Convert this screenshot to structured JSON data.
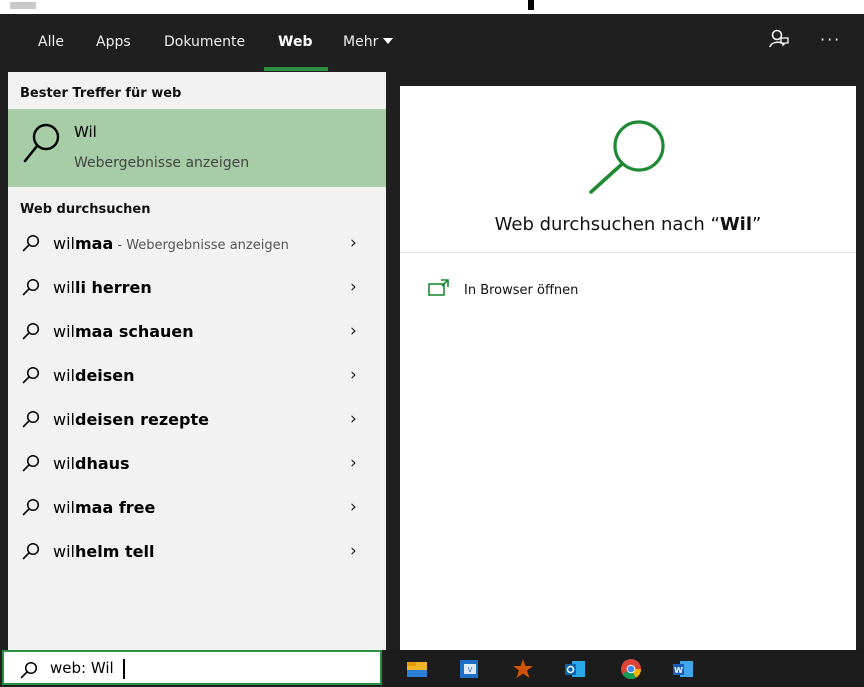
{
  "tabs": [
    {
      "label": "Alle",
      "active": false
    },
    {
      "label": "Apps",
      "active": false
    },
    {
      "label": "Dokumente",
      "active": false
    },
    {
      "label": "Web",
      "active": true
    },
    {
      "label": "Mehr",
      "active": false
    }
  ],
  "header_icons": [
    "feedback-icon",
    "more-options-icon"
  ],
  "more_label": "···",
  "best_match": {
    "section_title": "Bester Treffer für web",
    "title": "Wil",
    "subtitle": "Webergebnisse anzeigen"
  },
  "web_search": {
    "section_title": "Web durchsuchen",
    "suggestions": [
      {
        "prefix": "wil",
        "bold": "maa",
        "hint": " - Webergebnisse anzeigen"
      },
      {
        "prefix": "wil",
        "bold": "li herren",
        "hint": ""
      },
      {
        "prefix": "wil",
        "bold": "maa schauen",
        "hint": ""
      },
      {
        "prefix": "wil",
        "bold": "deisen",
        "hint": ""
      },
      {
        "prefix": "wil",
        "bold": "deisen rezepte",
        "hint": ""
      },
      {
        "prefix": "wil",
        "bold": "dhaus",
        "hint": ""
      },
      {
        "prefix": "wil",
        "bold": "maa free",
        "hint": ""
      },
      {
        "prefix": "wil",
        "bold": "helm tell",
        "hint": ""
      }
    ]
  },
  "preview": {
    "heading_prefix": "Web durchsuchen nach “",
    "heading_term": "Wil",
    "heading_suffix": "”",
    "open_in_browser": "In Browser öffnen"
  },
  "search_box": {
    "value": "web: Wil"
  },
  "taskbar_icons": [
    "file-explorer-icon",
    "vmware-icon",
    "star-app-icon",
    "outlook-icon",
    "chrome-icon",
    "word-icon"
  ],
  "colors": {
    "accent": "#2b9140",
    "selected_bg": "#a6cda6",
    "header_bg": "#1f1f1f"
  }
}
